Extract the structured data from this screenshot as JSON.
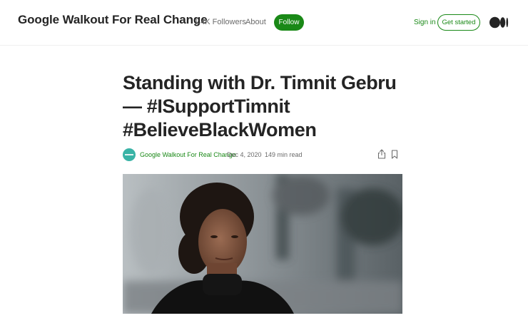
{
  "header": {
    "publication_name": "Google Walkout For Real Change",
    "followers": "1.4K Followers",
    "about_label": "About",
    "follow_label": "Follow",
    "signin_label": "Sign in",
    "get_started_label": "Get started"
  },
  "article": {
    "title": "Standing with Dr. Timnit Gebru — #ISupportTimnit #BelieveBlackWomen",
    "author": "Google Walkout For Real Change",
    "date": "Dec 4, 2020",
    "separator": "·",
    "read_time": "149 min read"
  },
  "colors": {
    "accent": "#1a8917",
    "text": "#242424",
    "muted": "#6b6b6b"
  },
  "icons": [
    "medium-logo-icon",
    "share-icon",
    "bookmark-icon",
    "avatar"
  ]
}
